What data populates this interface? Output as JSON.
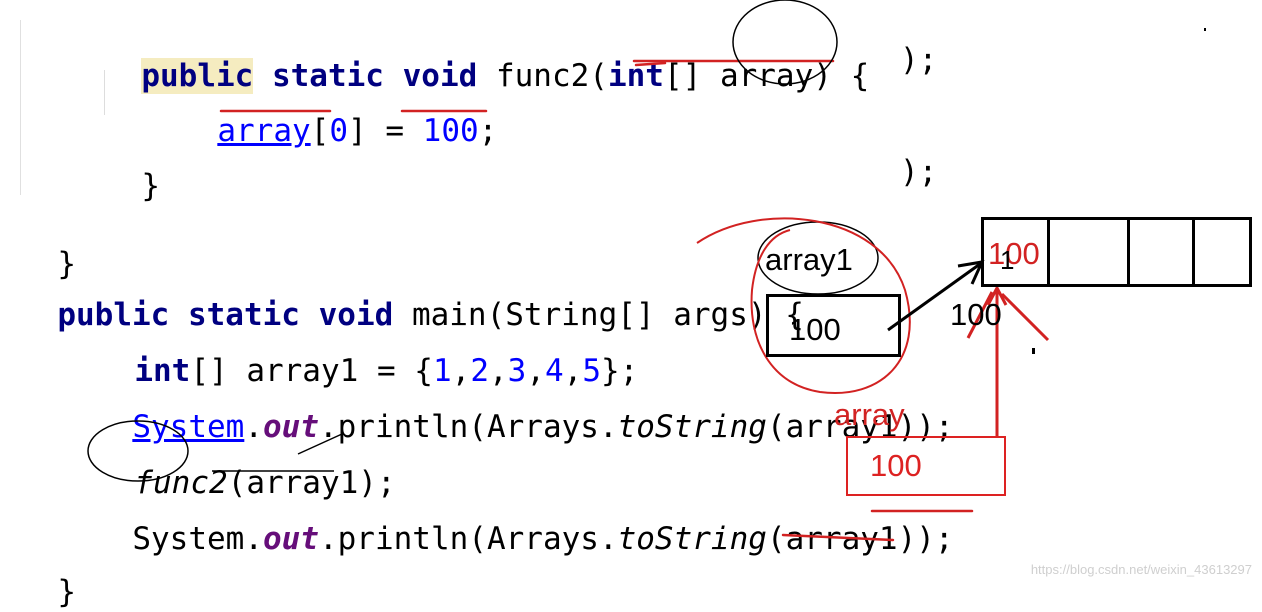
{
  "code": {
    "lines": [
      {
        "kw1": "public",
        "rest1": " static void ",
        "name": "func2",
        "p1": "(",
        "kw2": "int",
        "p2": "[] array) {"
      },
      {
        "var": "array",
        "idx_open": "[",
        "idx": "0",
        "idx_close": "]",
        "eq": " = ",
        "num": "100",
        "end": ";"
      },
      {
        "text": "}"
      },
      {
        "text": "}"
      },
      {
        "kw": "public static void ",
        "rest": "main(String[] args) {"
      },
      {
        "kw": "int",
        "rest1": "[] array1 = {",
        "n1": "1",
        "c1": ",",
        "n2": "2",
        "c2": ",",
        "n3": "3",
        "c3": ",",
        "n4": "4",
        "c4": ",",
        "n5": "5",
        "end": "};"
      },
      {
        "cls": "System",
        "dot1": ".",
        "field": "out",
        "mid": ".println(Arrays.",
        "method": "toString",
        "end": "(array1));"
      },
      {
        "call": "func2",
        "end": "(array1);"
      },
      {
        "cls": "System",
        "dot1": ".",
        "field": "out",
        "mid": ".println(Arrays.",
        "method": "toString",
        "end": "(array1));"
      },
      {
        "text": "}"
      }
    ],
    "stray": [
      ");",
      ");"
    ]
  },
  "annotations": {
    "ref_label": "array1",
    "ref_value": "100",
    "arrow_label": "100",
    "param_label": "array",
    "param_value": "100",
    "array_cell0": "100",
    "array_cell0_overwrite": "1"
  },
  "watermark": "https://blog.csdn.net/weixin_43613297",
  "colors": {
    "keyword": "#000080",
    "number": "#0000ff",
    "field": "#660e7a",
    "red_ink": "#d22222",
    "keyword_highlight": "#f5ecc0"
  }
}
